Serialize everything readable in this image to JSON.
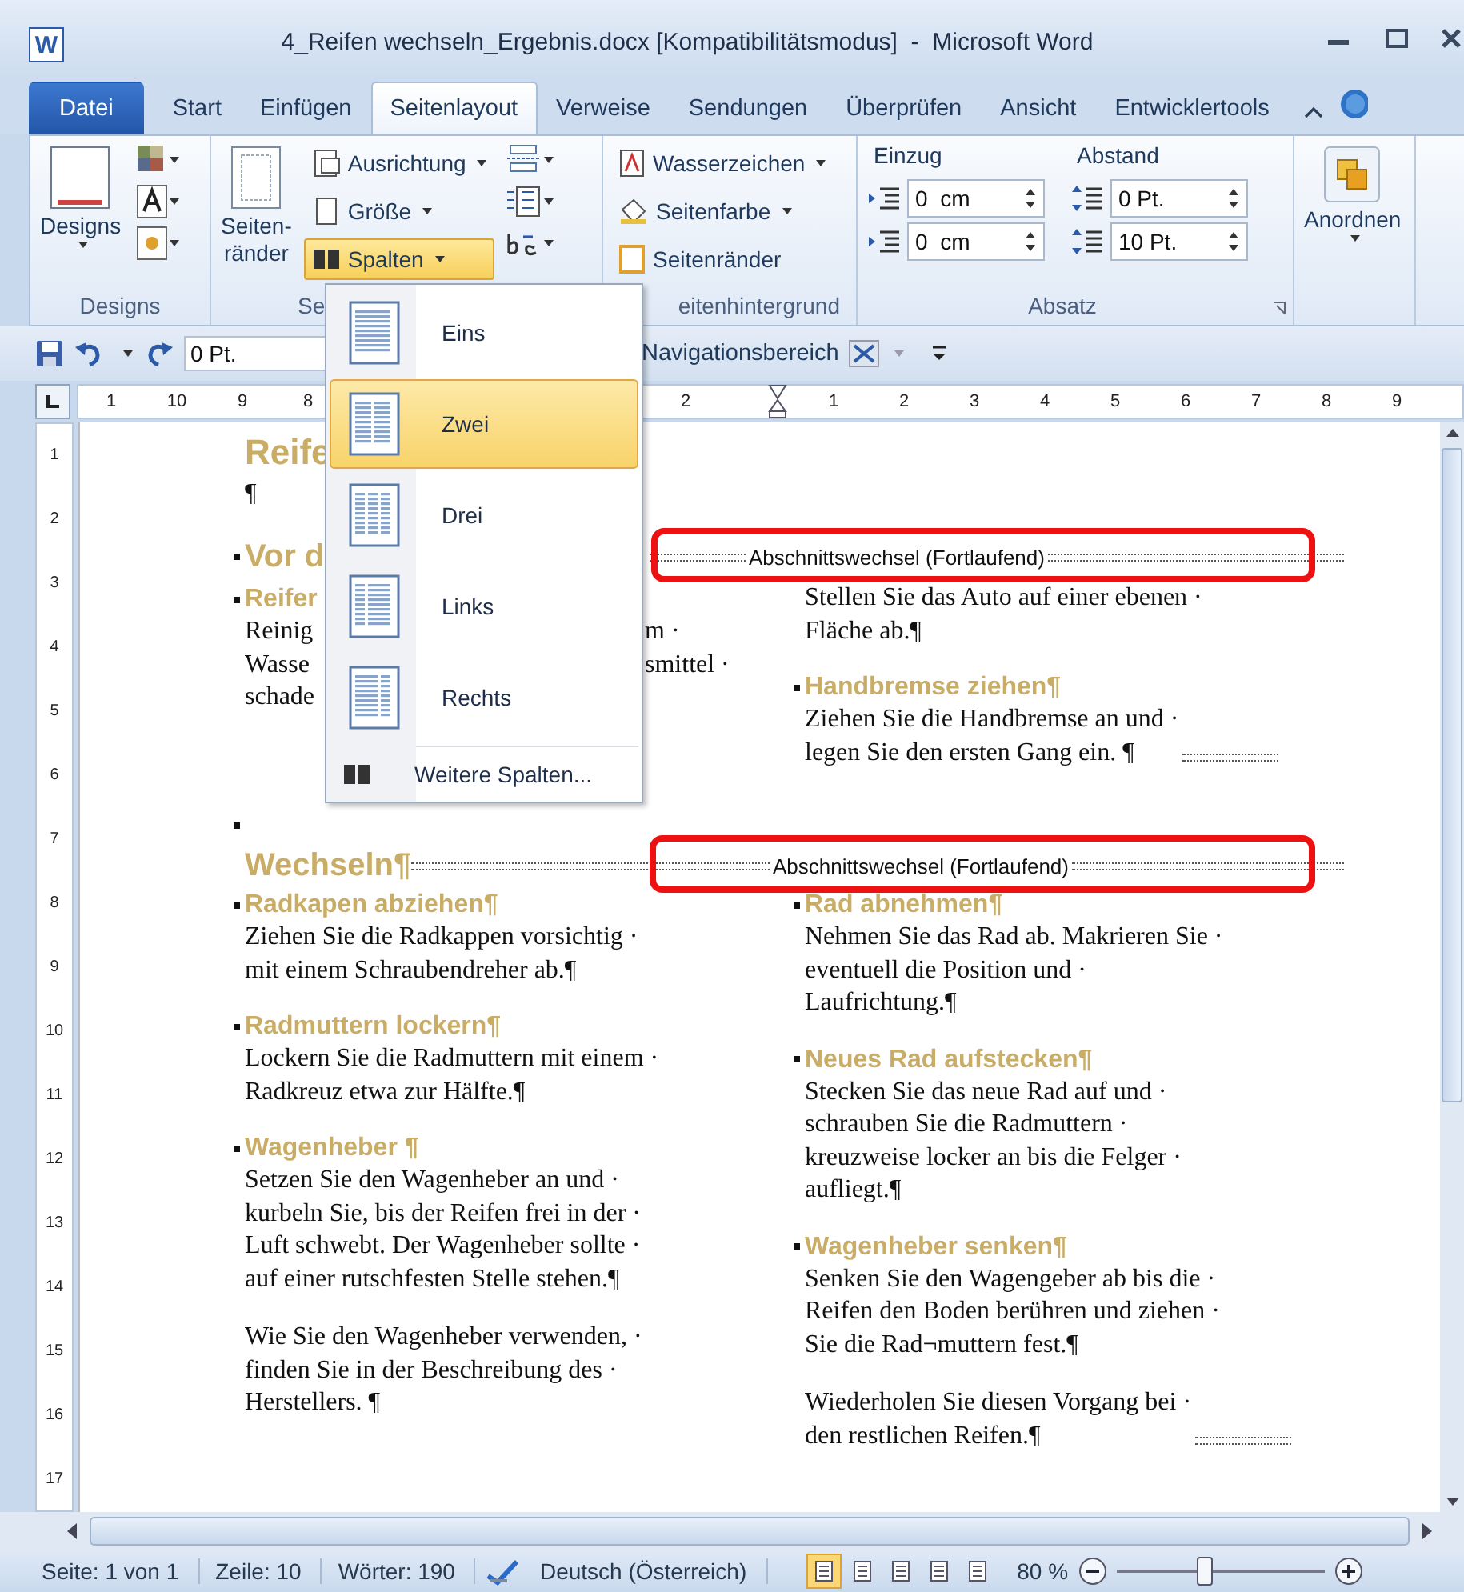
{
  "window": {
    "app_letter": "W",
    "title": "4_Reifen wechseln_Ergebnis.docx [Kompatibilitätsmodus]  -  Microsoft Word"
  },
  "tabs": [
    {
      "label": "Datei",
      "kind": "file",
      "selected": false
    },
    {
      "label": "Start",
      "kind": "tab",
      "selected": false
    },
    {
      "label": "Einfügen",
      "kind": "tab",
      "selected": false
    },
    {
      "label": "Seitenlayout",
      "kind": "tab",
      "selected": true
    },
    {
      "label": "Verweise",
      "kind": "tab",
      "selected": false
    },
    {
      "label": "Sendungen",
      "kind": "tab",
      "selected": false
    },
    {
      "label": "Überprüfen",
      "kind": "tab",
      "selected": false
    },
    {
      "label": "Ansicht",
      "kind": "tab",
      "selected": false
    },
    {
      "label": "Entwicklertools",
      "kind": "tab",
      "selected": false
    }
  ],
  "ribbon": {
    "designs": {
      "label": "Designs",
      "group": "Designs"
    },
    "page_setup": {
      "margins": [
        "Seiten-",
        "ränder"
      ],
      "orientation": "Ausrichtung",
      "size": "Größe",
      "columns": {
        "label": "Spalten",
        "active": true
      },
      "group": "Se"
    },
    "background": {
      "watermark": "Wasserzeichen",
      "page_color": "Seitenfarbe",
      "page_borders": "Seitenränder",
      "group": "eitenhintergrund"
    },
    "paragraph": {
      "indent_title": "Einzug",
      "indent": [
        "0  cm",
        "0  cm"
      ],
      "spacing_title": "Abstand",
      "spacing": [
        "0 Pt.",
        "10 Pt."
      ],
      "group": "Absatz"
    },
    "arrange": {
      "label": "Anordnen"
    }
  },
  "quick_access": {
    "field": "0 Pt.",
    "nav_pane": "Navigationsbereich"
  },
  "ruler": {
    "left_numbers": [
      "1",
      "10",
      "9",
      "8"
    ],
    "mid_numbers": [
      "2"
    ],
    "right_numbers": [
      "1",
      "2",
      "3",
      "4",
      "5",
      "6",
      "7",
      "8",
      "9"
    ],
    "vertical_numbers": [
      "1",
      "2",
      "3",
      "4",
      "5",
      "6",
      "7",
      "8",
      "9",
      "10",
      "11",
      "12",
      "13",
      "14",
      "15",
      "16",
      "17"
    ]
  },
  "column_menu": {
    "items": [
      {
        "label": "Eins",
        "kind": "one",
        "selected": false
      },
      {
        "label": "Zwei",
        "kind": "two",
        "selected": true
      },
      {
        "label": "Drei",
        "kind": "three",
        "selected": false
      },
      {
        "label": "Links",
        "kind": "left",
        "selected": false
      },
      {
        "label": "Rechts",
        "kind": "right",
        "selected": false
      }
    ],
    "more": "Weitere Spalten..."
  },
  "document": {
    "heading_top": "Reife",
    "empty_para": "¶",
    "heading_before": "Vor d",
    "break_1": "Abschnittswechsel (Fortlaufend)",
    "left_top": {
      "heading": "Reifer",
      "lines": [
        {
          "left": "Reinig",
          "right": "m ·"
        },
        {
          "left": "Wasse",
          "right": "smittel ·"
        },
        {
          "left": "schade"
        }
      ]
    },
    "right_top": [
      {
        "paragraphs": [
          {
            "lines": [
              "Stellen Sie das Auto auf einer ebenen ·",
              "Fläche ab.¶"
            ],
            "break_mark": false
          }
        ]
      },
      {
        "heading": "Handbremse ziehen¶",
        "paragraphs": [
          {
            "lines": [
              "Ziehen Sie die Handbremse an und ·",
              "legen Sie den ersten Gang ein. ¶"
            ],
            "break_mark": true
          }
        ]
      }
    ],
    "heading_change": "Wechseln¶",
    "break_2": "Abschnittswechsel (Fortlaufend)",
    "left_main": [
      {
        "heading": "Radkapen abziehen¶",
        "paragraphs": [
          {
            "lines": [
              "Ziehen Sie die Radkappen vorsichtig ·",
              "mit einem Schraubendreher ab.¶"
            ],
            "break_mark": false
          }
        ]
      },
      {
        "heading": "Radmuttern lockern¶",
        "paragraphs": [
          {
            "lines": [
              "Lockern Sie die Radmuttern mit einem ·",
              "Radkreuz etwa zur Hälfte.¶"
            ],
            "break_mark": false
          }
        ]
      },
      {
        "heading": "Wagenheber ¶",
        "paragraphs": [
          {
            "lines": [
              "Setzen Sie den Wagenheber an und ·",
              "kurbeln Sie, bis der Reifen frei in der ·",
              "Luft schwebt. Der Wagenheber sollte ·",
              "auf einer rutschfesten Stelle stehen.¶"
            ],
            "break_mark": false
          },
          {
            "lines": [
              "Wie Sie den Wagenheber verwenden, ·",
              "finden Sie in der Beschreibung des ·",
              "Herstellers. ¶"
            ],
            "break_mark": false
          }
        ]
      }
    ],
    "right_main": [
      {
        "heading": "Rad abnehmen¶",
        "paragraphs": [
          {
            "lines": [
              "Nehmen Sie das Rad ab. Makrieren Sie ·",
              "eventuell die Position und ·",
              "Laufrichtung.¶"
            ],
            "break_mark": false
          }
        ]
      },
      {
        "heading": "Neues Rad aufstecken¶",
        "paragraphs": [
          {
            "lines": [
              "Stecken Sie das neue Rad auf und ·",
              "schrauben Sie die Radmuttern ·",
              "kreuzweise locker an bis die Felger ·",
              "aufliegt.¶"
            ],
            "break_mark": false
          }
        ]
      },
      {
        "heading": "Wagenheber senken¶",
        "paragraphs": [
          {
            "lines": [
              "Senken Sie den Wagengeber ab bis die ·",
              "Reifen den Boden berühren und ziehen ·",
              "Sie die Rad¬muttern fest.¶"
            ],
            "break_mark": false
          },
          {
            "lines": [
              "Wiederholen Sie diesen Vorgang bei ·",
              "den restlichen Reifen.¶"
            ],
            "break_mark": true
          }
        ]
      }
    ]
  },
  "status_bar": {
    "page": "Seite: 1 von 1",
    "line": "Zeile: 10",
    "words": "Wörter: 190",
    "language": "Deutsch (Österreich)",
    "views": [
      {
        "selected": true
      },
      {
        "selected": false
      },
      {
        "selected": false
      },
      {
        "selected": false
      },
      {
        "selected": false
      }
    ],
    "zoom": "80 %",
    "zoom_slider": {
      "level": 0.42
    }
  }
}
